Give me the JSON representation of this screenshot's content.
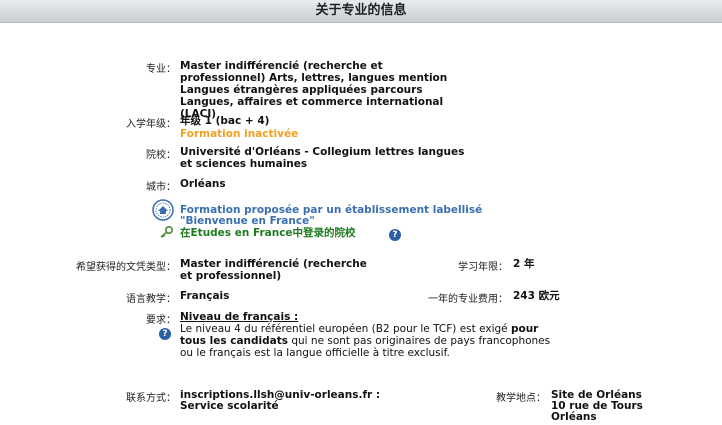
{
  "header": {
    "title": "关于专业的信息"
  },
  "fields": {
    "specialty": {
      "label": "专业：",
      "value": "Master indifférencié (recherche et professionnel) Arts, lettres, langues mention Langues étrangères appliquées parcours Langues, affaires et commerce international (LACI)"
    },
    "entry_level": {
      "label": "入学年级：",
      "value": "年级 1 (bac + 4)",
      "status": "Formation inactivée"
    },
    "institution": {
      "label": "院校：",
      "value": "Université d'Orléans - Collegium lettres langues et sciences humaines"
    },
    "city": {
      "label": "城市：",
      "value": "Orléans"
    },
    "labelled": {
      "line1": "Formation proposée par un établissement labellisé",
      "line2": "\"Bienvenue en France\"",
      "registered": "在Etudes en France中登录的院校",
      "help": "?"
    },
    "diploma": {
      "label": "希望获得的文凭类型：",
      "value": "Master indifférencié (recherche et professionnel)"
    },
    "duration": {
      "label": "学习年限：",
      "value": "2 年"
    },
    "language": {
      "label": "语言教学：",
      "value": "Français"
    },
    "tuition": {
      "label": "一年的专业费用：",
      "value": "243 欧元"
    },
    "requirements": {
      "label": "要求：",
      "title": "Niveau de français :",
      "text_part1": "Le niveau 4 du référentiel européen (B2 pour le TCF) est exigé ",
      "text_bold": "pour tous les candidats",
      "text_part2": " qui ne sont pas originaires de pays francophones ou le français est la langue officielle à titre exclusif.",
      "help": "?"
    },
    "contact": {
      "label": "联系方式：",
      "email": "inscriptions.llsh@univ-orleans.fr :",
      "service": "Service scolarité"
    },
    "location": {
      "label": "教学地点：",
      "line1": "Site de Orléans",
      "line2": "10 rue de Tours",
      "line3": "Orléans"
    }
  },
  "colors": {
    "orange": "#f0a020",
    "blue": "#3a6fb0",
    "green": "#1f7a1f",
    "help": "#2a5fa8"
  }
}
